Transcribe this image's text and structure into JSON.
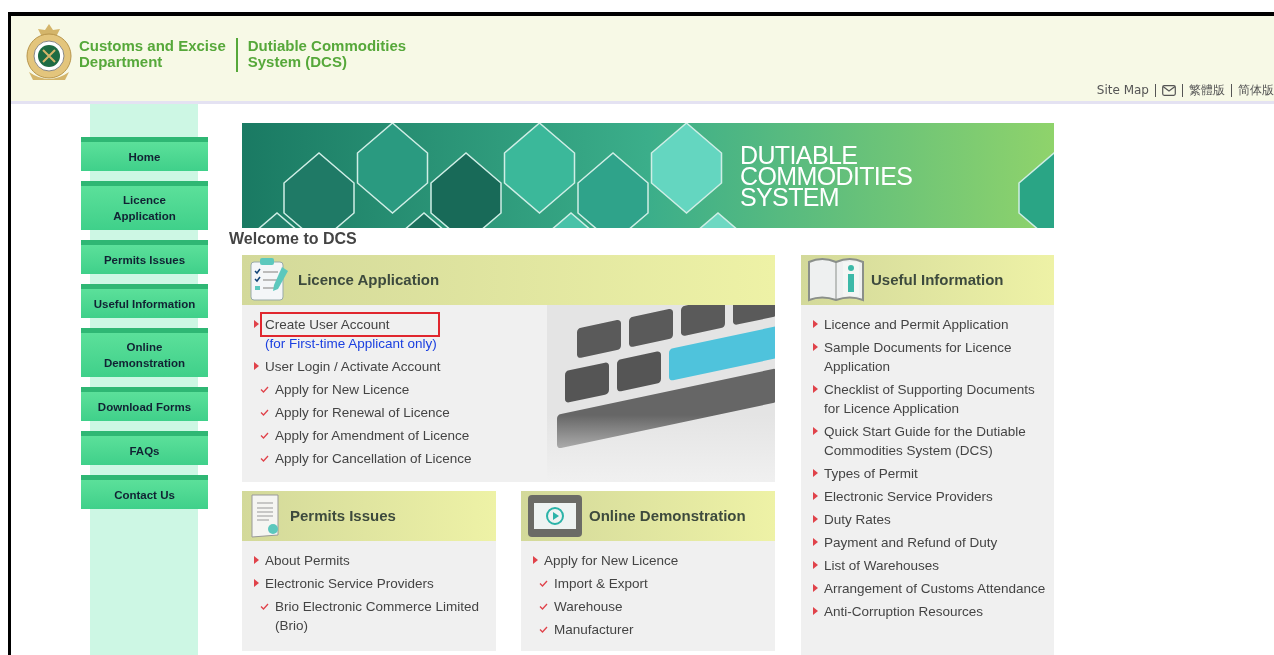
{
  "header": {
    "department": [
      "Customs and Excise",
      "Department"
    ],
    "system": [
      "Dutiable Commodities",
      "System (DCS)"
    ],
    "links": [
      {
        "kind": "text",
        "label": "Site Map"
      },
      {
        "kind": "mail"
      },
      {
        "kind": "text",
        "label": "繁體版"
      },
      {
        "kind": "text",
        "label": "简体版"
      }
    ]
  },
  "sidebar": {
    "items": [
      {
        "label": "Home"
      },
      {
        "label": "Licence Application"
      },
      {
        "label": "Permits Issues"
      },
      {
        "label": "Useful Information"
      },
      {
        "label": "Online Demonstration"
      },
      {
        "label": "Download Forms"
      },
      {
        "label": "FAQs"
      },
      {
        "label": "Contact Us"
      }
    ]
  },
  "banner": {
    "title": [
      "DUTIABLE",
      "COMMODITIES",
      "SYSTEM"
    ]
  },
  "welcome": "Welcome to DCS",
  "panels": [
    {
      "title": "Licence Application",
      "items": [
        {
          "kind": "arrow",
          "label": "Create User Account",
          "highlighted": true,
          "note": "(for First-time Applicant only)"
        },
        {
          "kind": "arrow",
          "label": "User Login / Activate Account",
          "highlighted": false
        },
        {
          "kind": "check",
          "label": "Apply for New Licence",
          "highlighted": false
        },
        {
          "kind": "check",
          "label": "Apply for Renewal of Licence",
          "highlighted": false
        },
        {
          "kind": "check",
          "label": "Apply for Amendment of Licence",
          "highlighted": false
        },
        {
          "kind": "check",
          "label": "Apply for Cancellation of Licence",
          "highlighted": false
        }
      ]
    },
    {
      "title": "Useful Information",
      "items": [
        {
          "kind": "arrow",
          "label": "Licence and Permit Application",
          "highlighted": false
        },
        {
          "kind": "arrow",
          "label": "Sample Documents for Licence Application",
          "highlighted": false
        },
        {
          "kind": "arrow",
          "label": "Checklist of Supporting Documents for Licence Application",
          "highlighted": false
        },
        {
          "kind": "arrow",
          "label": "Quick Start Guide for the Dutiable Commodities System (DCS)",
          "highlighted": false
        },
        {
          "kind": "arrow",
          "label": "Types of Permit",
          "highlighted": false
        },
        {
          "kind": "arrow",
          "label": "Electronic Service Providers",
          "highlighted": false
        },
        {
          "kind": "arrow",
          "label": "Duty Rates",
          "highlighted": false
        },
        {
          "kind": "arrow",
          "label": "Payment and Refund of Duty",
          "highlighted": false
        },
        {
          "kind": "arrow",
          "label": "List of Warehouses",
          "highlighted": false
        },
        {
          "kind": "arrow",
          "label": "Arrangement of Customs Attendance",
          "highlighted": false
        },
        {
          "kind": "arrow",
          "label": "Anti-Corruption Resources",
          "highlighted": false
        }
      ]
    },
    {
      "title": "Permits Issues",
      "items": [
        {
          "kind": "arrow",
          "label": "About Permits",
          "highlighted": false
        },
        {
          "kind": "arrow",
          "label": "Electronic Service Providers",
          "highlighted": false
        },
        {
          "kind": "check",
          "label": "Brio Electronic Commerce Limited (Brio)",
          "highlighted": false
        }
      ]
    },
    {
      "title": "Online Demonstration",
      "items": [
        {
          "kind": "arrow",
          "label": "Apply for New Licence",
          "highlighted": false
        },
        {
          "kind": "check",
          "label": "Import & Export",
          "highlighted": false
        },
        {
          "kind": "check",
          "label": "Warehouse",
          "highlighted": false
        },
        {
          "kind": "check",
          "label": "Manufacturer",
          "highlighted": false
        }
      ]
    }
  ]
}
